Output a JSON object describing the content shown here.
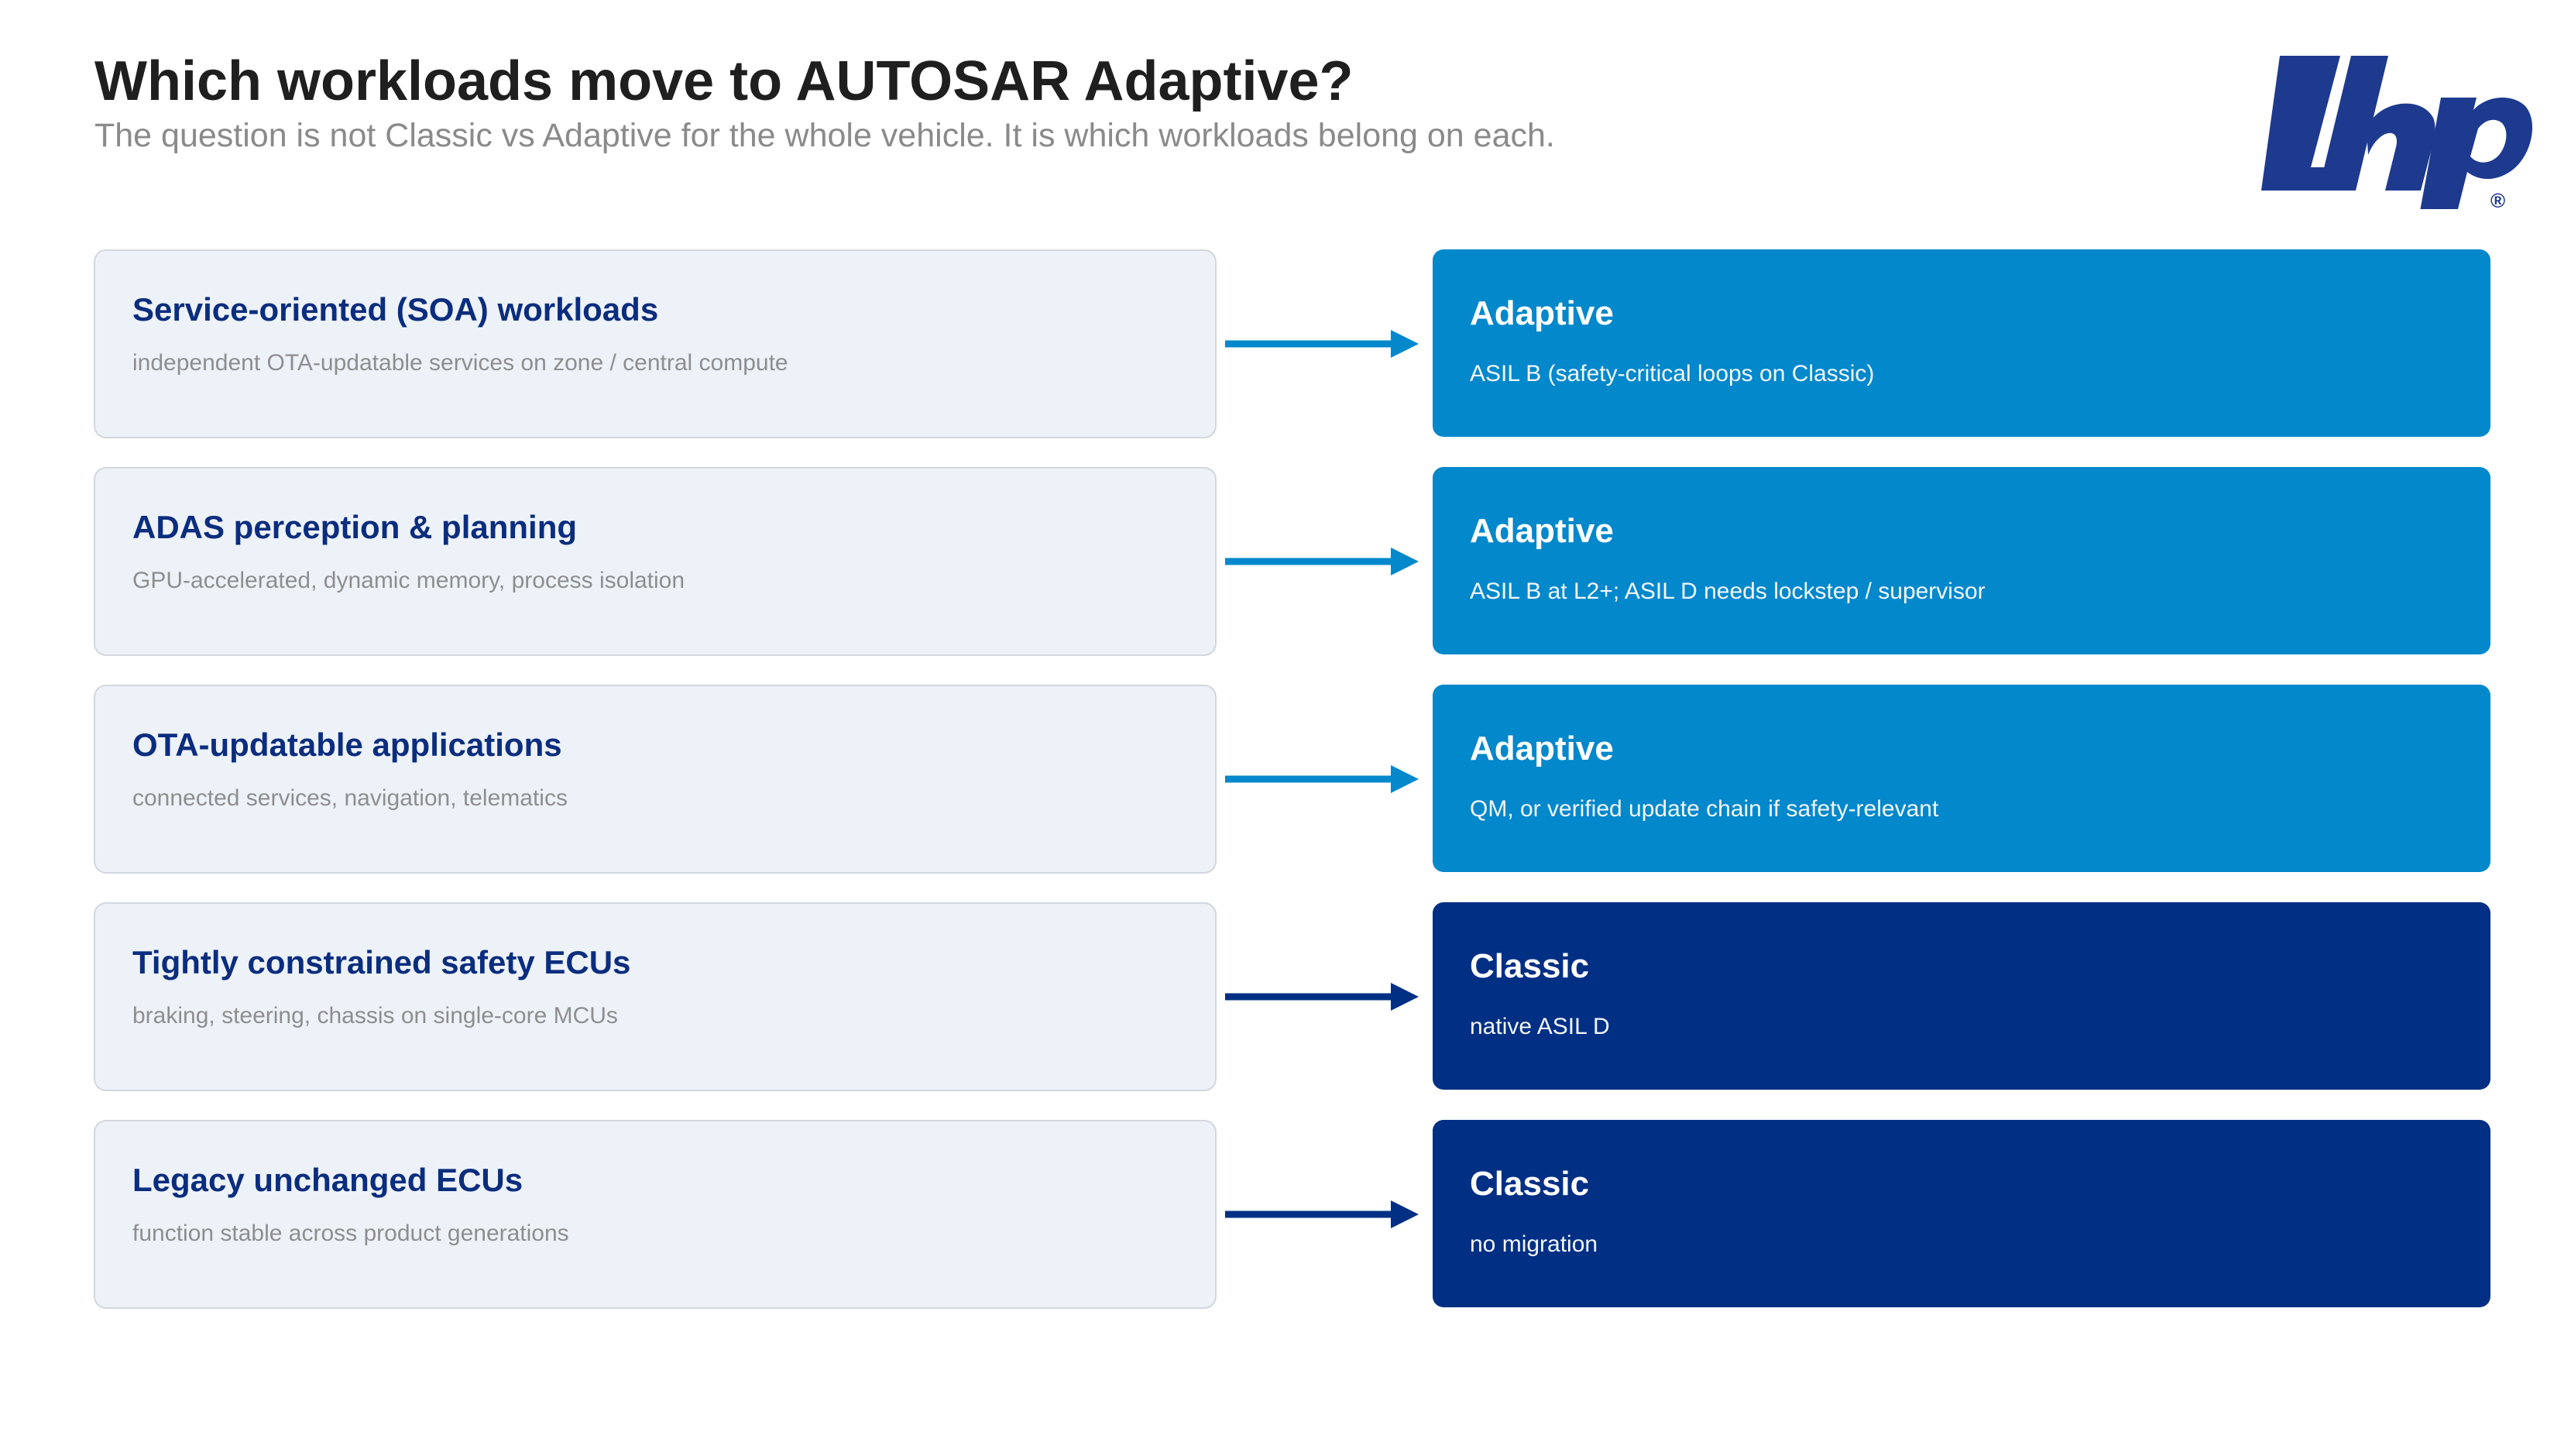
{
  "header": {
    "title": "Which workloads move to AUTOSAR Adaptive?",
    "subtitle": "The question is not Classic vs Adaptive for the whole vehicle. It is which workloads belong on each."
  },
  "logo": {
    "text": "Lhp",
    "registered_mark": "®",
    "color": "#1e3a8f"
  },
  "colors": {
    "adaptive": "#0288cb",
    "classic": "#012f84",
    "source_bg": "#edf2f9",
    "source_title": "#0b2d7e"
  },
  "rows": [
    {
      "workload": "Service-oriented (SOA) workloads",
      "workload_desc": "independent OTA-updatable services on zone / central compute",
      "platform": "Adaptive",
      "platform_desc": "ASIL B (safety-critical loops on Classic)"
    },
    {
      "workload": "ADAS perception & planning",
      "workload_desc": "GPU-accelerated, dynamic memory, process isolation",
      "platform": "Adaptive",
      "platform_desc": "ASIL B at L2+; ASIL D needs lockstep / supervisor"
    },
    {
      "workload": "OTA-updatable applications",
      "workload_desc": "connected services, navigation, telematics",
      "platform": "Adaptive",
      "platform_desc": "QM, or verified update chain if safety-relevant"
    },
    {
      "workload": "Tightly constrained safety ECUs",
      "workload_desc": "braking, steering, chassis on single-core MCUs",
      "platform": "Classic",
      "platform_desc": "native ASIL D"
    },
    {
      "workload": "Legacy unchanged ECUs",
      "workload_desc": "function stable across product generations",
      "platform": "Classic",
      "platform_desc": "no migration"
    }
  ]
}
